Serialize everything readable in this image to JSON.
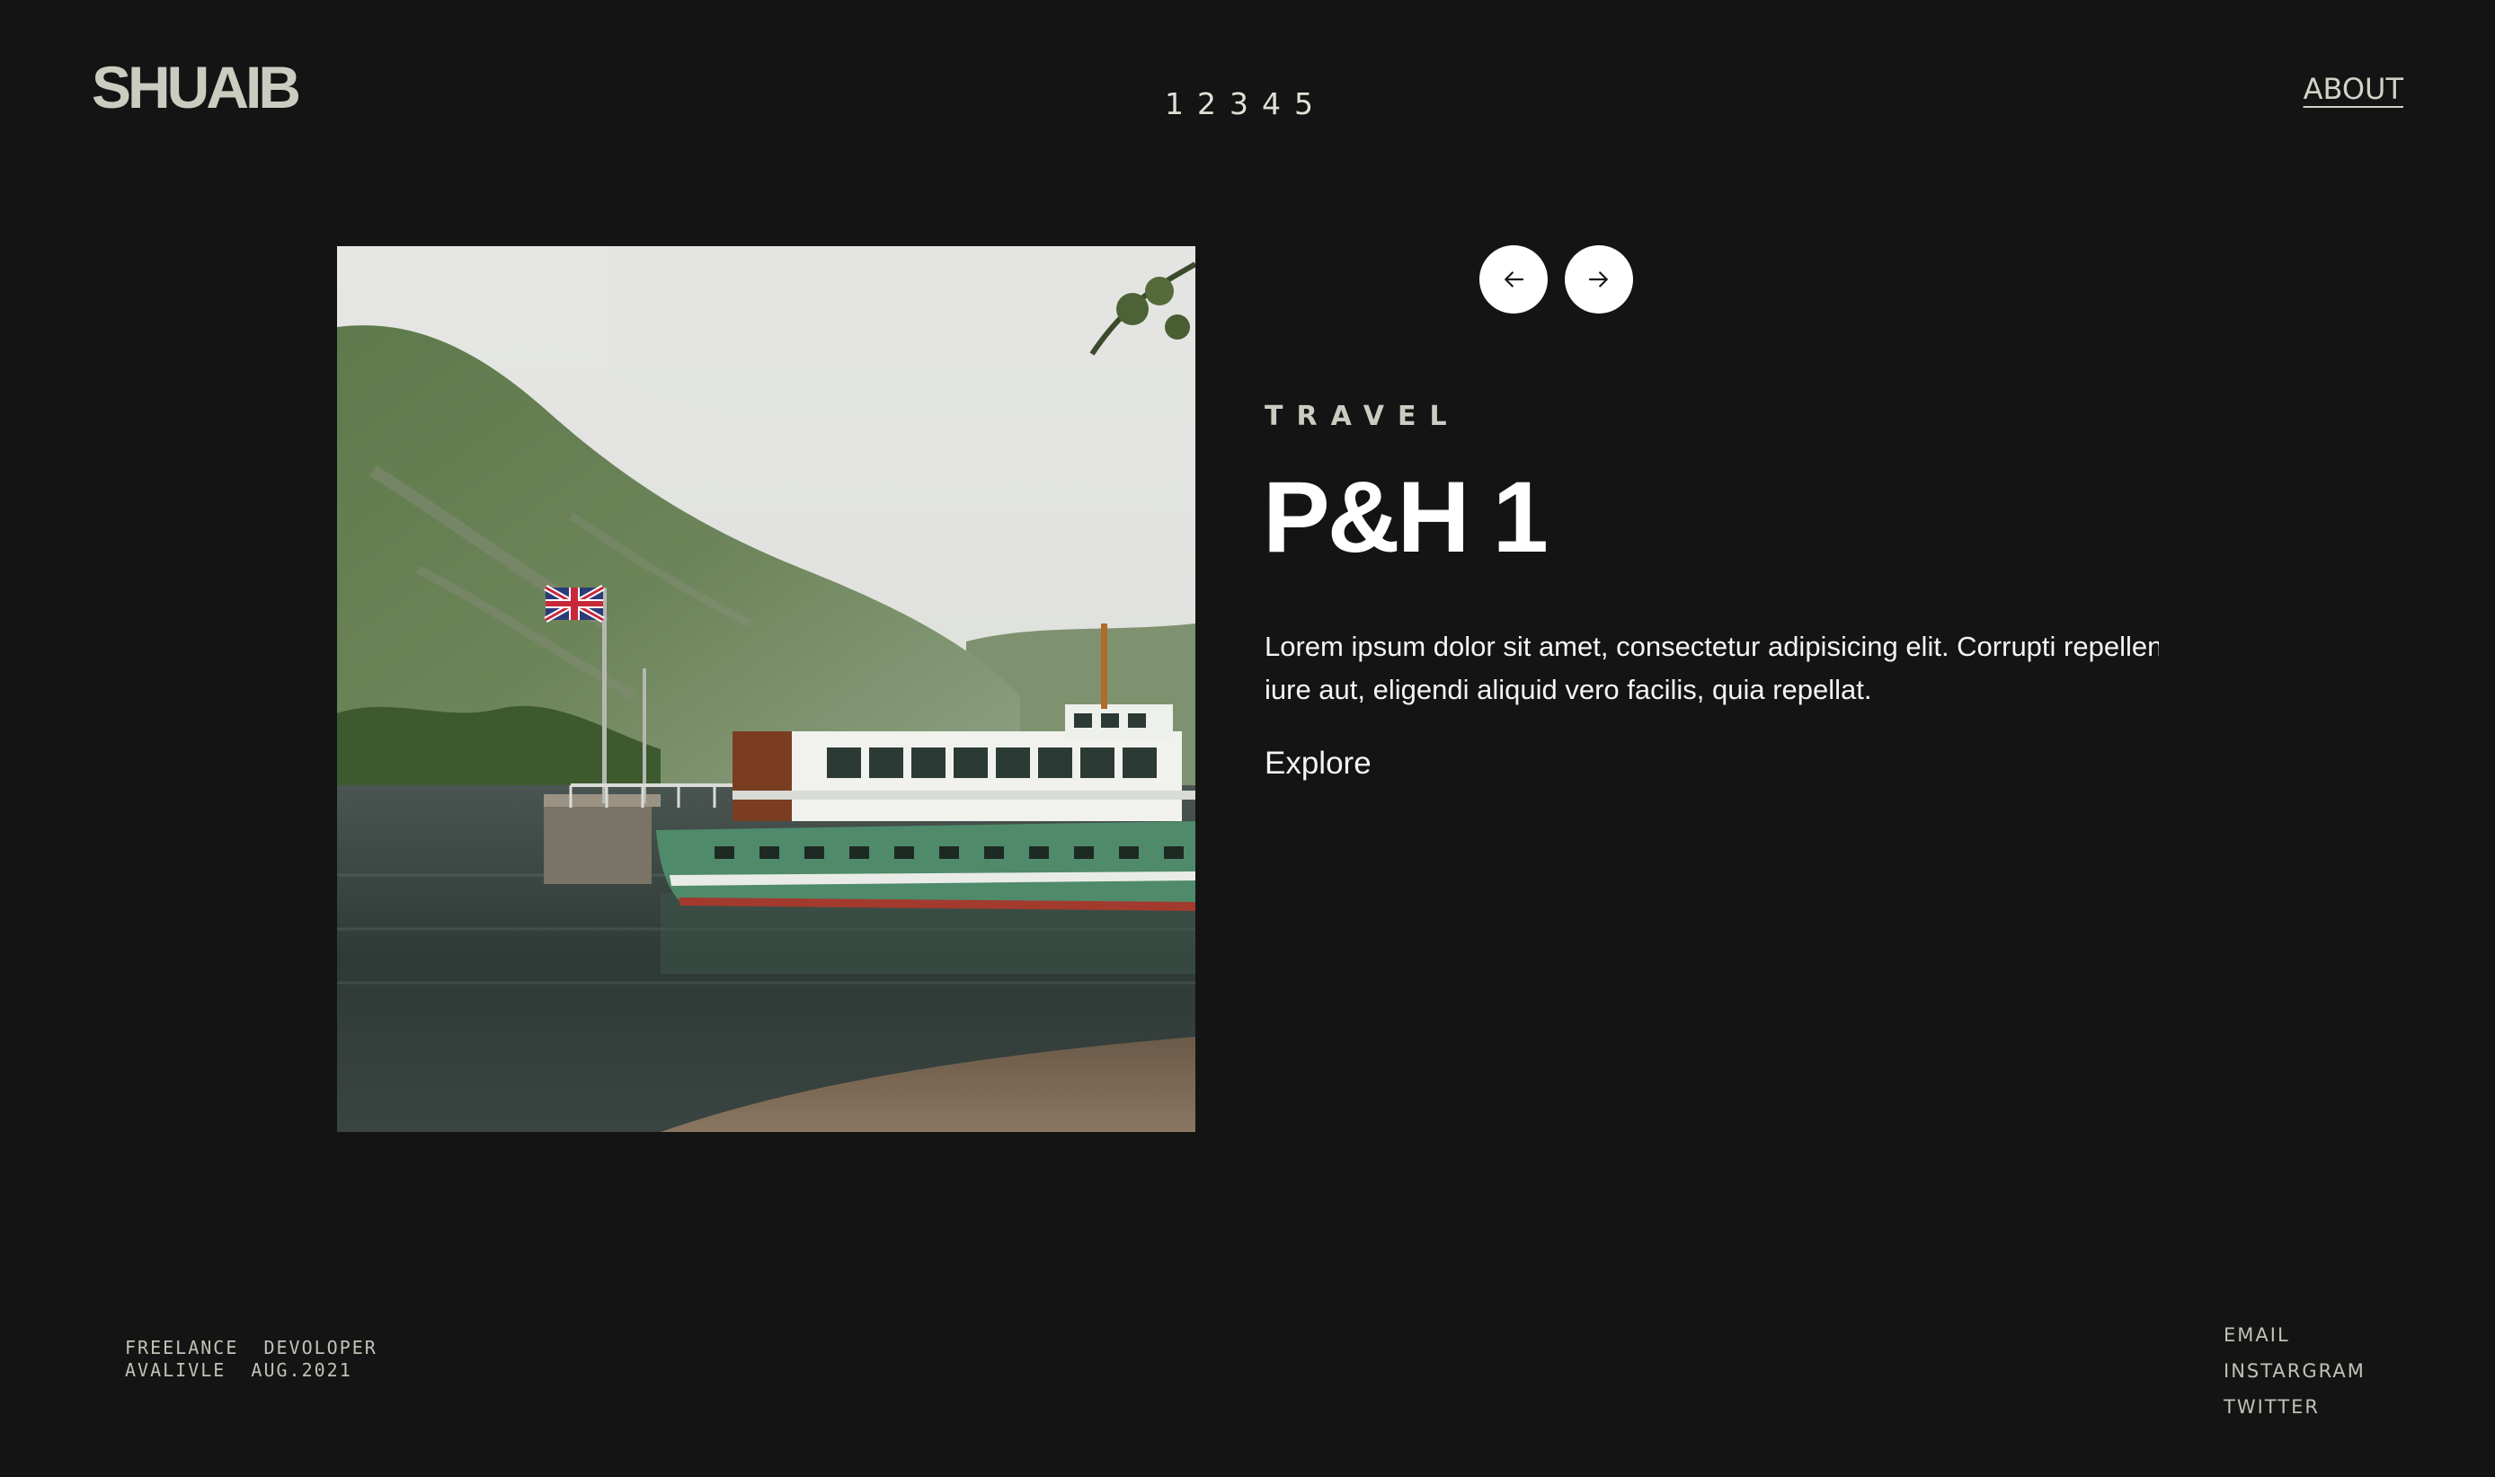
{
  "header": {
    "logo": "SHUAIB",
    "pages": [
      "1",
      "2",
      "3",
      "4",
      "5"
    ],
    "about_label": "ABOUT"
  },
  "slide": {
    "category": "TRAVEL",
    "title": "P&H 1",
    "description_lines": [
      "Lorem ipsum dolor sit amet, consectetur adipisicing elit. Corrupti repellendus vel nemo",
      "iure aut, eligendi aliquid vero facilis, quia repellat."
    ],
    "explore_label": "Explore"
  },
  "footer": {
    "info_lines": [
      "FREELANCE  DEVOLOPER",
      "AVALIVLE  AUG.2021"
    ],
    "social_links": [
      "EMAIL",
      "INSTARGRAM",
      "TWITTER"
    ]
  },
  "icons": {
    "prev": "arrow-left-icon",
    "next": "arrow-right-icon"
  },
  "colors": {
    "background": "#141414",
    "logo": "#c9cdc0",
    "text": "#f4f4f1",
    "button": "#ffffff"
  }
}
